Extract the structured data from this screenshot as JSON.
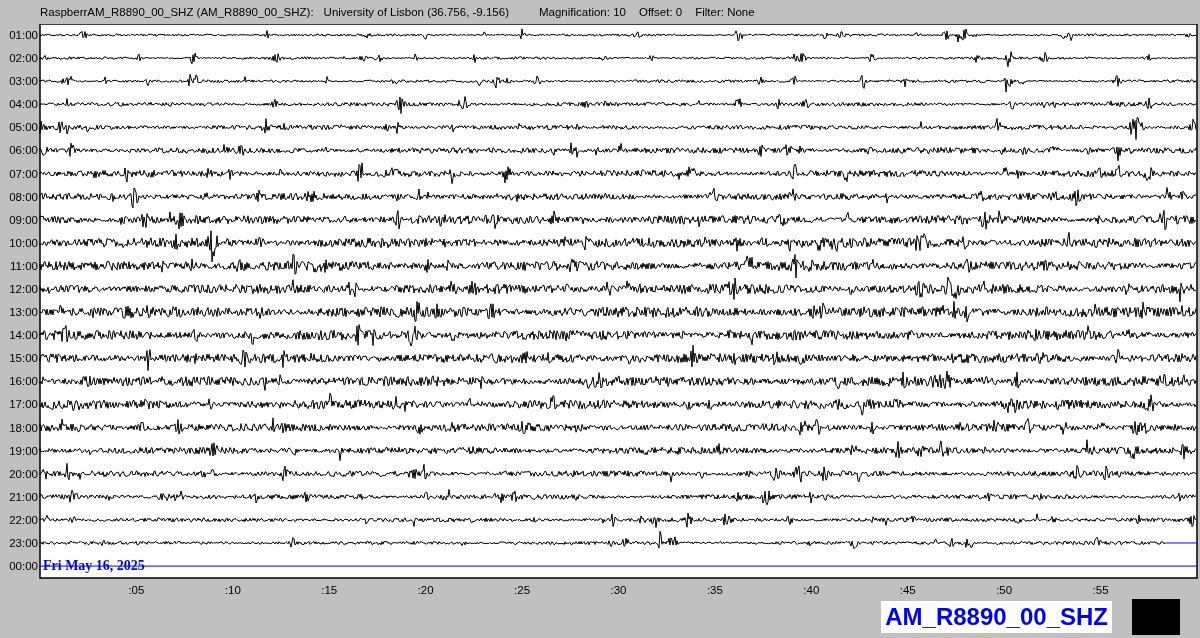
{
  "header": {
    "station": "RaspberrAM_R8890_00_SHZ (AM_R8890_00_SHZ):",
    "location": "University of Lisbon (36.756, -9.156)",
    "magnification": "Magnification: 10",
    "offset": "Offset: 0",
    "filter": "Filter: None"
  },
  "rows": [
    {
      "label": "01:00",
      "kind": "full"
    },
    {
      "label": "02:00",
      "kind": "full"
    },
    {
      "label": "03:00",
      "kind": "full"
    },
    {
      "label": "04:00",
      "kind": "full"
    },
    {
      "label": "05:00",
      "kind": "full"
    },
    {
      "label": "06:00",
      "kind": "full"
    },
    {
      "label": "07:00",
      "kind": "full"
    },
    {
      "label": "08:00",
      "kind": "full"
    },
    {
      "label": "09:00",
      "kind": "full"
    },
    {
      "label": "10:00",
      "kind": "full"
    },
    {
      "label": "11:00",
      "kind": "full"
    },
    {
      "label": "12:00",
      "kind": "full"
    },
    {
      "label": "13:00",
      "kind": "full"
    },
    {
      "label": "14:00",
      "kind": "full"
    },
    {
      "label": "15:00",
      "kind": "full"
    },
    {
      "label": "16:00",
      "kind": "full"
    },
    {
      "label": "17:00",
      "kind": "full"
    },
    {
      "label": "18:00",
      "kind": "full"
    },
    {
      "label": "19:00",
      "kind": "full"
    },
    {
      "label": "20:00",
      "kind": "full"
    },
    {
      "label": "21:00",
      "kind": "full"
    },
    {
      "label": "22:00",
      "kind": "full"
    },
    {
      "label": "23:00",
      "kind": "partial"
    },
    {
      "label": "00:00",
      "kind": "current"
    }
  ],
  "date_label": "Fri May 16, 2025",
  "x_ticks": [
    ":05",
    ":10",
    ":15",
    ":20",
    ":25",
    ":30",
    ":35",
    ":40",
    ":45",
    ":50",
    ":55"
  ],
  "station_badge": "AM_R8890_00_SHZ"
}
